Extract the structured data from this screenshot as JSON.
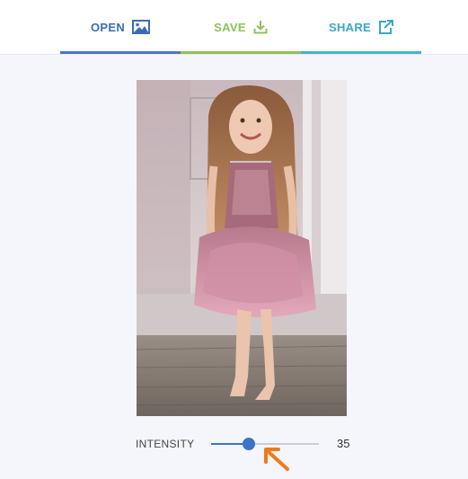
{
  "toolbar": {
    "open_label": "OPEN",
    "save_label": "SAVE",
    "share_label": "SHARE",
    "open_icon": "image-icon",
    "save_icon": "download-icon",
    "share_icon": "share-icon"
  },
  "colors": {
    "open": "#3b6db4",
    "save": "#8fc25a",
    "share": "#3aa7c8",
    "slider_accent": "#3d74c7",
    "annotation_arrow": "#f07a1a"
  },
  "controls": {
    "intensity_label": "INTENSITY",
    "intensity_value": "35",
    "intensity_fraction": 0.35
  }
}
